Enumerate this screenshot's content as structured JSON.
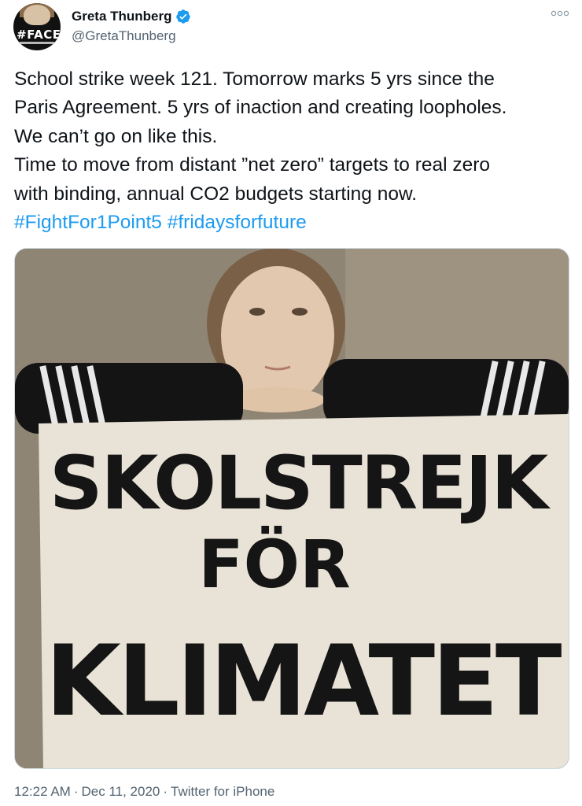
{
  "author": {
    "display_name": "Greta Thunberg",
    "handle": "@GretaThunberg",
    "avatar_text": "#FACE",
    "verified": true
  },
  "tweet": {
    "lines": [
      "School strike week 121. Tomorrow marks 5 yrs since the",
      "Paris Agreement. 5 yrs of inaction and creating loopholes.",
      "We can’t go on like this.",
      "Time to move from distant ”net zero” targets to real zero",
      "with binding, annual CO2 budgets starting now."
    ],
    "hashtags": [
      "#FightFor1Point5",
      "#fridaysforfuture"
    ]
  },
  "media": {
    "sign_lines": [
      "SKOLSTREJK",
      "FÖR",
      "KLIMATET"
    ]
  },
  "meta": {
    "time": "12:22 AM",
    "date": "Dec 11, 2020",
    "source": "Twitter for iPhone",
    "separator": "·"
  },
  "colors": {
    "link": "#1d9bf0",
    "verified": "#1d9bf0",
    "secondary_text": "#536471"
  }
}
